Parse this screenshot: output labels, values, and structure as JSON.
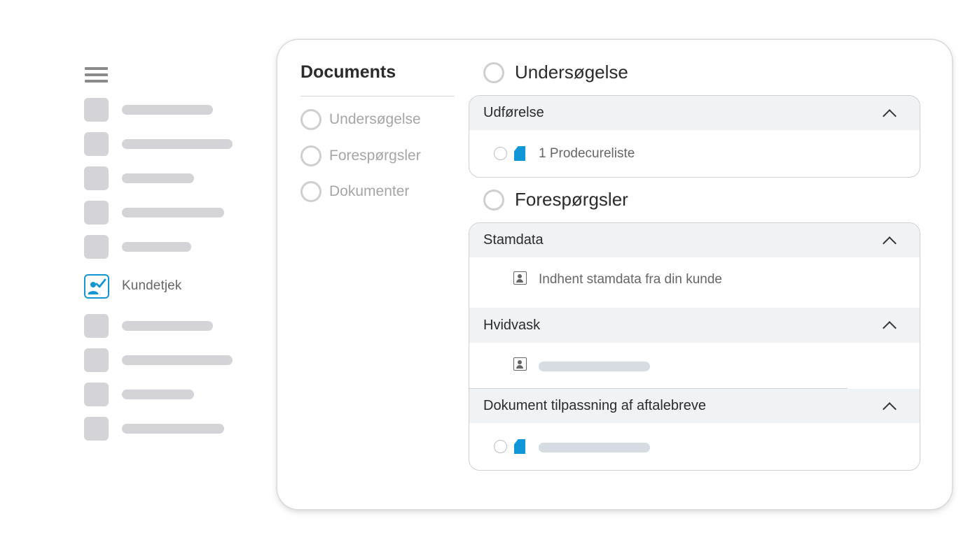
{
  "nav": {
    "active_label": "Kundetjek",
    "icons": {
      "menu": "hamburger-menu-icon",
      "active": "user-check-icon"
    }
  },
  "documents": {
    "title": "Documents",
    "items": [
      "Undersøgelse",
      "Forespørgsler",
      "Dokumenter"
    ]
  },
  "sections": [
    {
      "title": "Undersøgelse",
      "groups": [
        {
          "title": "Udførelse",
          "row": {
            "type": "document",
            "label": "1 Prodecureliste"
          }
        }
      ]
    },
    {
      "title": "Forespørgsler",
      "groups": [
        {
          "title": "Stamdata",
          "row": {
            "type": "contact",
            "label": "Indhent stamdata fra din kunde"
          }
        },
        {
          "title": "Hvidvask",
          "row": {
            "type": "contact",
            "label": ""
          }
        },
        {
          "title": "Dokument tilpassning af aftalebreve",
          "row": {
            "type": "document",
            "label": ""
          }
        }
      ]
    }
  ],
  "colors": {
    "accent": "#1596d4",
    "placeholder": "#d4d3d8",
    "header_bg": "#eff3f6",
    "muted_text": "#a6a6a6"
  }
}
